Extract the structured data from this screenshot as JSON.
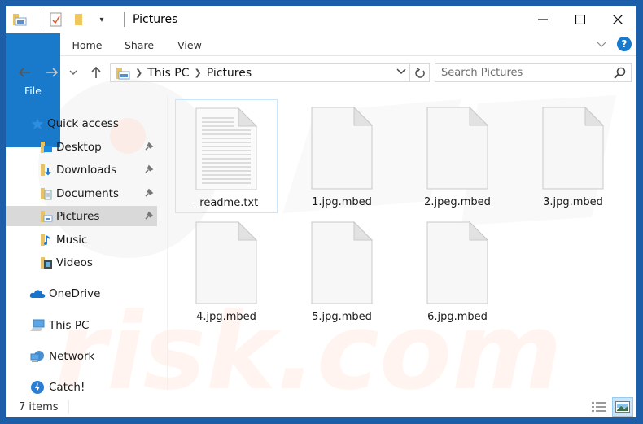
{
  "window": {
    "title": "Pictures",
    "controls": {
      "minimize": "minimize",
      "maximize": "maximize",
      "close": "close"
    }
  },
  "ribbon": {
    "tabs": [
      {
        "label": "File",
        "active": true
      },
      {
        "label": "Home"
      },
      {
        "label": "Share"
      },
      {
        "label": "View"
      }
    ],
    "help_label": "?"
  },
  "address": {
    "crumbs": [
      "This PC",
      "Pictures"
    ],
    "search_placeholder": "Search Pictures"
  },
  "nav": {
    "quick_access": "Quick access",
    "items": [
      {
        "label": "Desktop",
        "icon": "desktop-folder-icon",
        "pinned": true
      },
      {
        "label": "Downloads",
        "icon": "downloads-folder-icon",
        "pinned": true
      },
      {
        "label": "Documents",
        "icon": "documents-folder-icon",
        "pinned": true
      },
      {
        "label": "Pictures",
        "icon": "pictures-folder-icon",
        "pinned": true,
        "selected": true
      },
      {
        "label": "Music",
        "icon": "music-folder-icon",
        "pinned": false
      },
      {
        "label": "Videos",
        "icon": "videos-folder-icon",
        "pinned": false
      }
    ],
    "roots": [
      {
        "label": "OneDrive",
        "icon": "onedrive-icon"
      },
      {
        "label": "This PC",
        "icon": "this-pc-icon"
      },
      {
        "label": "Network",
        "icon": "network-icon"
      },
      {
        "label": "Catch!",
        "icon": "catch-icon"
      }
    ]
  },
  "files": [
    {
      "name": "_readme.txt",
      "type": "text",
      "selected": true
    },
    {
      "name": "1.jpg.mbed",
      "type": "blank"
    },
    {
      "name": "2.jpeg.mbed",
      "type": "blank"
    },
    {
      "name": "3.jpg.mbed",
      "type": "blank"
    },
    {
      "name": "4.jpg.mbed",
      "type": "blank"
    },
    {
      "name": "5.jpg.mbed",
      "type": "blank"
    },
    {
      "name": "6.jpg.mbed",
      "type": "blank"
    }
  ],
  "status": {
    "item_count": "7 items"
  },
  "colors": {
    "accent": "#1979ca",
    "frame": "#1d5ea8",
    "selected_nav": "#d9d9d9",
    "selected_file_border": "#cce4f7"
  }
}
